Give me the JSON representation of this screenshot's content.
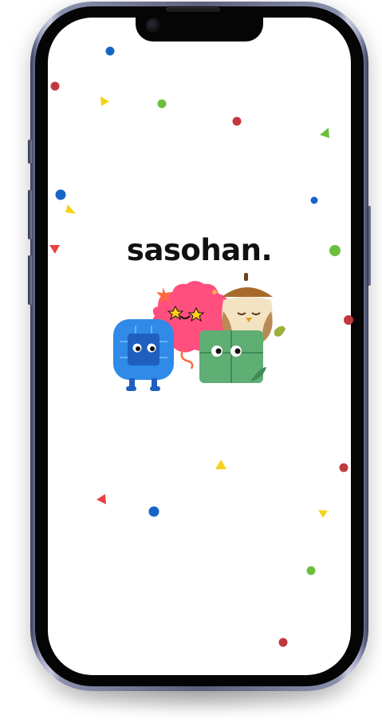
{
  "app": {
    "logo_text": "sasohan."
  },
  "mascots": [
    "blue-chip-monster",
    "pink-brain-monster",
    "owl-acorn-monster",
    "green-cube-monster"
  ],
  "colors": {
    "frame": "#8b90ae",
    "bezel": "#050505",
    "screen": "#ffffff",
    "logo": "#111111",
    "confetti_red": "#c0383e",
    "confetti_blue": "#1565c8",
    "confetti_green": "#6cbf3c",
    "confetti_yellow": "#f5d21a",
    "mascot_blue": "#2f8ae8",
    "mascot_pink": "#ff4f7f",
    "mascot_beige": "#f3e3c3",
    "mascot_green": "#5fae74"
  }
}
